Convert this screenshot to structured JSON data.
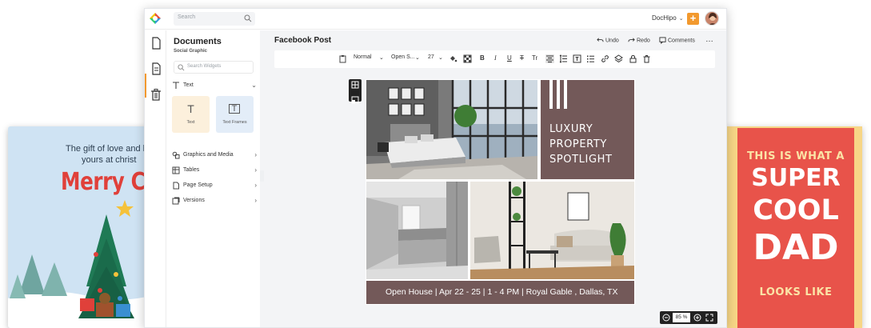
{
  "app": {
    "search_placeholder": "Search",
    "brand": "DocHipo",
    "brand_chevron": "⌄",
    "plus_label": "+"
  },
  "panel": {
    "title": "Documents",
    "subtitle": "Social Graphic",
    "search_placeholder": "Search Widgets",
    "text_section": "Text",
    "tile_text": "Text",
    "tile_text_glyph": "T",
    "tile_frames": "Text Frames",
    "tile_frames_glyph": "T",
    "graphics": "Graphics and Media",
    "tables": "Tables",
    "page_setup": "Page Setup",
    "versions": "Versions",
    "chevron_right": "›",
    "chevron_down": "⌄"
  },
  "editor": {
    "doc_title": "Facebook Post",
    "undo": "Undo",
    "redo": "Redo",
    "comments": "Comments",
    "more": "…"
  },
  "toolbar": {
    "style": "Normal",
    "font": "Open S...",
    "size": "27",
    "b": "B",
    "i": "I",
    "u": "U",
    "s": "T",
    "case": "Tr",
    "chev": "⌄"
  },
  "design": {
    "headline": [
      "LUXURY",
      "PROPERTY",
      "SPOTLIGHT"
    ],
    "footer": "Open House | Apr 22 - 25 | 1 - 4 PM | Royal Gable , Dallas, TX"
  },
  "zoom": {
    "value": "85 %"
  },
  "card_left": {
    "line1": "The gift of love and h",
    "line2": "yours at christ",
    "headline": "Merry Chr"
  },
  "card_right": {
    "line1": "THIS IS WHAT A",
    "big1": "SUPER",
    "big2": "COOL",
    "big3": "DAD",
    "line2": "LOOKS LIKE"
  },
  "colors": {
    "accent": "#f2992e",
    "design_brown": "#735959",
    "xmas_red": "#e0403a",
    "dad_red": "#e8534a",
    "dad_yellow": "#f7d686"
  }
}
